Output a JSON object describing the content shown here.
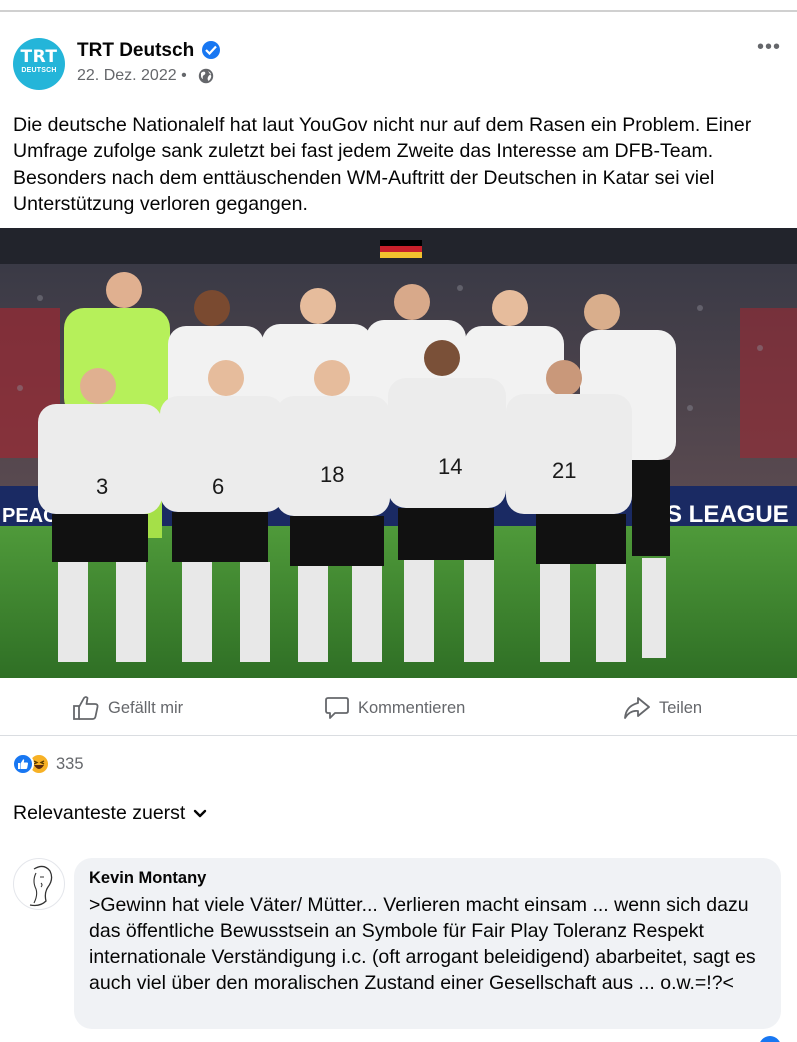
{
  "post": {
    "page_name": "TRT Deutsch",
    "avatar_text_top": "TRT",
    "avatar_text_bottom": "DEUTSCH",
    "date": "22. Dez. 2022",
    "separator": "•",
    "privacy_icon": "globe-icon",
    "more_icon": "more-options-icon",
    "more_glyph": "•••",
    "text": "Die deutsche Nationalelf hat laut YouGov nicht nur auf dem Rasen ein Problem. Einer Umfrage zufolge sank zuletzt bei fast jedem Zweite das Interesse am DFB-Team. Besonders nach dem enttäuschenden WM-Auftritt der Deutschen in Katar sei viel Unterstützung verloren gegangen.",
    "photo": {
      "board_left": "PEAC",
      "board_right": "S LEAGUE",
      "jersey_numbers": [
        "3",
        "6",
        "18",
        "14",
        "21"
      ]
    }
  },
  "actions": {
    "like_label": "Gefällt mir",
    "comment_label": "Kommentieren",
    "share_label": "Teilen"
  },
  "reactions": {
    "types": [
      "like",
      "haha"
    ],
    "count": "335"
  },
  "comments": {
    "sort_label": "Relevanteste zuerst",
    "items": [
      {
        "author": "Kevin Montany",
        "text": ">Gewinn hat viele Väter/ Mütter... Verlieren macht einsam ... wenn sich dazu das öffentliche Bewusstsein an Symbole für Fair Play Toleranz Respekt internationale Verständigung i.c. (oft arrogant beleidigend) abarbeitet, sagt es auch viel über den moralischen Zustand einer Gesellschaft aus ... o.w.=!?<"
      }
    ]
  },
  "colors": {
    "accent": "#1877f2",
    "secondary_text": "#65676b",
    "comment_bubble": "#f0f2f5",
    "avatar_bg": "#24b5d9"
  }
}
